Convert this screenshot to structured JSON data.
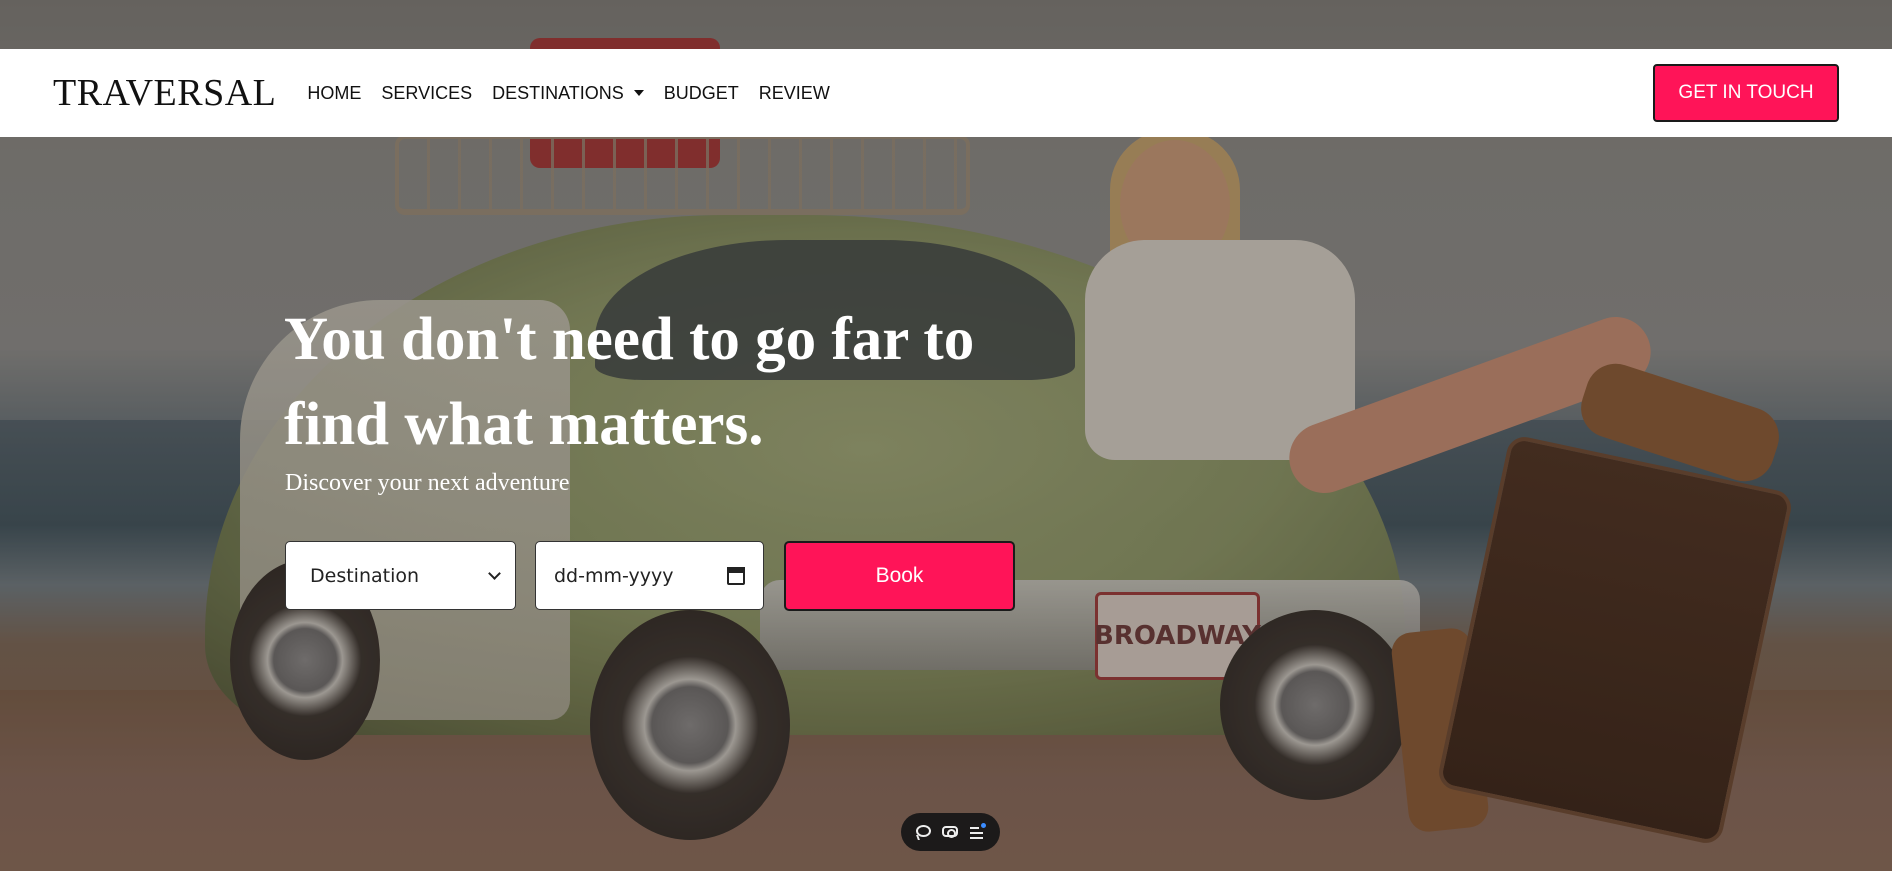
{
  "brand": {
    "name": "TRAVERSAL"
  },
  "nav": {
    "items": [
      {
        "label": "HOME"
      },
      {
        "label": "SERVICES"
      },
      {
        "label": "DESTINATIONS",
        "dropdown": true
      },
      {
        "label": "BUDGET"
      },
      {
        "label": "REVIEW"
      }
    ],
    "cta_label": "GET IN TOUCH"
  },
  "hero": {
    "title_line1": "You don't need to go far to",
    "title_line2": "find what matters.",
    "subtitle": "Discover your next adventure",
    "plate_text": "BROADWAY"
  },
  "booking": {
    "destination_value": "Destination",
    "date_placeholder": "dd-mm-yyyy",
    "book_label": "Book"
  },
  "toolbar": {
    "icons": [
      "chat-icon",
      "eye-icon",
      "list-icon"
    ]
  },
  "colors": {
    "accent": "#ff1458",
    "navbar_bg": "#ffffff",
    "text_dark": "#111111",
    "hero_text": "#ffffff"
  }
}
